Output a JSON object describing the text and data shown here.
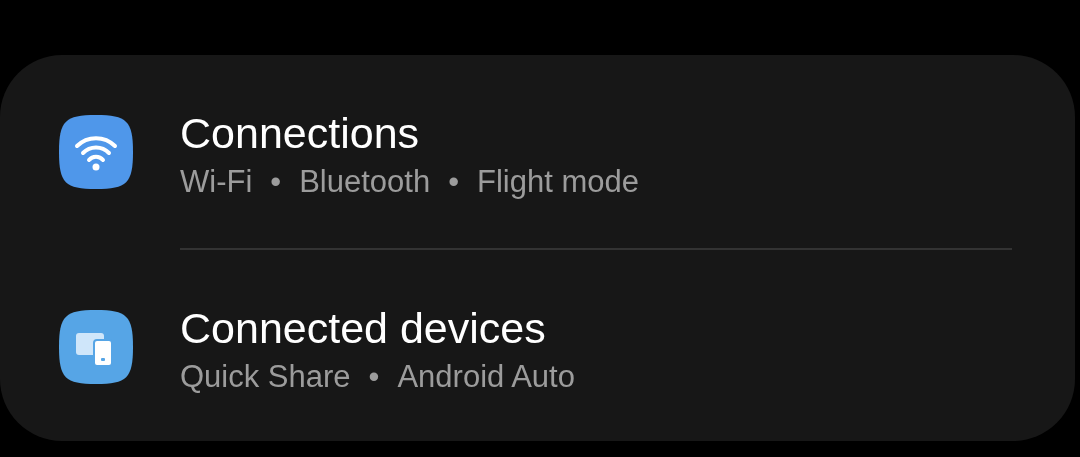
{
  "items": [
    {
      "title": "Connections",
      "kind": "wifi",
      "separator": "•",
      "details": [
        "Wi-Fi",
        "Bluetooth",
        "Flight mode"
      ]
    },
    {
      "title": "Connected devices",
      "kind": "devices",
      "separator": "•",
      "details": [
        "Quick Share",
        "Android Auto"
      ]
    }
  ]
}
